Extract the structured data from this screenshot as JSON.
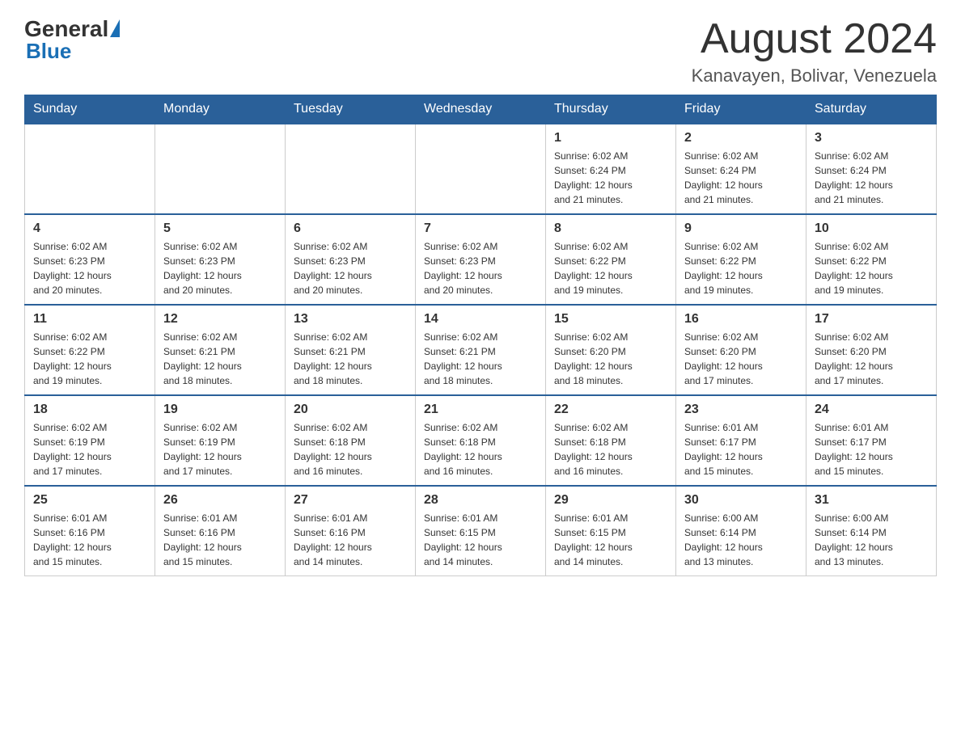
{
  "header": {
    "logo": {
      "general": "General",
      "blue": "Blue"
    },
    "month_year": "August 2024",
    "location": "Kanavayen, Bolivar, Venezuela"
  },
  "weekdays": [
    "Sunday",
    "Monday",
    "Tuesday",
    "Wednesday",
    "Thursday",
    "Friday",
    "Saturday"
  ],
  "weeks": [
    [
      {
        "day": "",
        "info": ""
      },
      {
        "day": "",
        "info": ""
      },
      {
        "day": "",
        "info": ""
      },
      {
        "day": "",
        "info": ""
      },
      {
        "day": "1",
        "info": "Sunrise: 6:02 AM\nSunset: 6:24 PM\nDaylight: 12 hours\nand 21 minutes."
      },
      {
        "day": "2",
        "info": "Sunrise: 6:02 AM\nSunset: 6:24 PM\nDaylight: 12 hours\nand 21 minutes."
      },
      {
        "day": "3",
        "info": "Sunrise: 6:02 AM\nSunset: 6:24 PM\nDaylight: 12 hours\nand 21 minutes."
      }
    ],
    [
      {
        "day": "4",
        "info": "Sunrise: 6:02 AM\nSunset: 6:23 PM\nDaylight: 12 hours\nand 20 minutes."
      },
      {
        "day": "5",
        "info": "Sunrise: 6:02 AM\nSunset: 6:23 PM\nDaylight: 12 hours\nand 20 minutes."
      },
      {
        "day": "6",
        "info": "Sunrise: 6:02 AM\nSunset: 6:23 PM\nDaylight: 12 hours\nand 20 minutes."
      },
      {
        "day": "7",
        "info": "Sunrise: 6:02 AM\nSunset: 6:23 PM\nDaylight: 12 hours\nand 20 minutes."
      },
      {
        "day": "8",
        "info": "Sunrise: 6:02 AM\nSunset: 6:22 PM\nDaylight: 12 hours\nand 19 minutes."
      },
      {
        "day": "9",
        "info": "Sunrise: 6:02 AM\nSunset: 6:22 PM\nDaylight: 12 hours\nand 19 minutes."
      },
      {
        "day": "10",
        "info": "Sunrise: 6:02 AM\nSunset: 6:22 PM\nDaylight: 12 hours\nand 19 minutes."
      }
    ],
    [
      {
        "day": "11",
        "info": "Sunrise: 6:02 AM\nSunset: 6:22 PM\nDaylight: 12 hours\nand 19 minutes."
      },
      {
        "day": "12",
        "info": "Sunrise: 6:02 AM\nSunset: 6:21 PM\nDaylight: 12 hours\nand 18 minutes."
      },
      {
        "day": "13",
        "info": "Sunrise: 6:02 AM\nSunset: 6:21 PM\nDaylight: 12 hours\nand 18 minutes."
      },
      {
        "day": "14",
        "info": "Sunrise: 6:02 AM\nSunset: 6:21 PM\nDaylight: 12 hours\nand 18 minutes."
      },
      {
        "day": "15",
        "info": "Sunrise: 6:02 AM\nSunset: 6:20 PM\nDaylight: 12 hours\nand 18 minutes."
      },
      {
        "day": "16",
        "info": "Sunrise: 6:02 AM\nSunset: 6:20 PM\nDaylight: 12 hours\nand 17 minutes."
      },
      {
        "day": "17",
        "info": "Sunrise: 6:02 AM\nSunset: 6:20 PM\nDaylight: 12 hours\nand 17 minutes."
      }
    ],
    [
      {
        "day": "18",
        "info": "Sunrise: 6:02 AM\nSunset: 6:19 PM\nDaylight: 12 hours\nand 17 minutes."
      },
      {
        "day": "19",
        "info": "Sunrise: 6:02 AM\nSunset: 6:19 PM\nDaylight: 12 hours\nand 17 minutes."
      },
      {
        "day": "20",
        "info": "Sunrise: 6:02 AM\nSunset: 6:18 PM\nDaylight: 12 hours\nand 16 minutes."
      },
      {
        "day": "21",
        "info": "Sunrise: 6:02 AM\nSunset: 6:18 PM\nDaylight: 12 hours\nand 16 minutes."
      },
      {
        "day": "22",
        "info": "Sunrise: 6:02 AM\nSunset: 6:18 PM\nDaylight: 12 hours\nand 16 minutes."
      },
      {
        "day": "23",
        "info": "Sunrise: 6:01 AM\nSunset: 6:17 PM\nDaylight: 12 hours\nand 15 minutes."
      },
      {
        "day": "24",
        "info": "Sunrise: 6:01 AM\nSunset: 6:17 PM\nDaylight: 12 hours\nand 15 minutes."
      }
    ],
    [
      {
        "day": "25",
        "info": "Sunrise: 6:01 AM\nSunset: 6:16 PM\nDaylight: 12 hours\nand 15 minutes."
      },
      {
        "day": "26",
        "info": "Sunrise: 6:01 AM\nSunset: 6:16 PM\nDaylight: 12 hours\nand 15 minutes."
      },
      {
        "day": "27",
        "info": "Sunrise: 6:01 AM\nSunset: 6:16 PM\nDaylight: 12 hours\nand 14 minutes."
      },
      {
        "day": "28",
        "info": "Sunrise: 6:01 AM\nSunset: 6:15 PM\nDaylight: 12 hours\nand 14 minutes."
      },
      {
        "day": "29",
        "info": "Sunrise: 6:01 AM\nSunset: 6:15 PM\nDaylight: 12 hours\nand 14 minutes."
      },
      {
        "day": "30",
        "info": "Sunrise: 6:00 AM\nSunset: 6:14 PM\nDaylight: 12 hours\nand 13 minutes."
      },
      {
        "day": "31",
        "info": "Sunrise: 6:00 AM\nSunset: 6:14 PM\nDaylight: 12 hours\nand 13 minutes."
      }
    ]
  ]
}
